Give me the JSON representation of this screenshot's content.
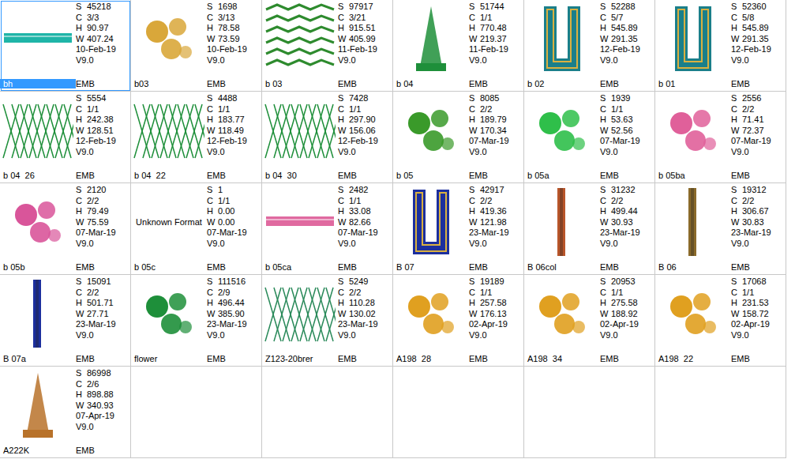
{
  "field_labels": [
    "S",
    "C",
    "H",
    "W"
  ],
  "items": [
    {
      "name": "bh",
      "values": [
        "45218",
        "3/3",
        "90.97",
        "407.24"
      ],
      "date": "10-Feb-19",
      "version": "V9.0",
      "format": "EMB",
      "kind": "band",
      "color": "#1fb5a8",
      "selected": true
    },
    {
      "name": "b03",
      "values": [
        "1698",
        "3/13",
        "78.58",
        "73.59"
      ],
      "date": "10-Feb-19",
      "version": "V9.0",
      "format": "EMB",
      "kind": "motif",
      "color": "#d9a73a",
      "selected": false
    },
    {
      "name": "b 03",
      "values": [
        "97917",
        "3/21",
        "915.51",
        "405.99"
      ],
      "date": "11-Feb-19",
      "version": "V9.0",
      "format": "EMB",
      "kind": "zigzag",
      "color": "#2e8b2e",
      "selected": false
    },
    {
      "name": "b 04",
      "values": [
        "51744",
        "1/1",
        "770.48",
        "219.37"
      ],
      "date": "11-Feb-19",
      "version": "V9.0",
      "format": "EMB",
      "kind": "triangle",
      "color": "#1e8f3a",
      "selected": false
    },
    {
      "name": "b 02",
      "values": [
        "52288",
        "5/7",
        "545.89",
        "291.35"
      ],
      "date": "12-Feb-19",
      "version": "V9.0",
      "format": "EMB",
      "kind": "vshape",
      "color": "#1a7f8a",
      "selected": false
    },
    {
      "name": "b 01",
      "values": [
        "52360",
        "5/8",
        "545.89",
        "291.35"
      ],
      "date": "12-Feb-19",
      "version": "V9.0",
      "format": "EMB",
      "kind": "vshape",
      "color": "#1a7f8a",
      "selected": false
    },
    {
      "name": "b 04  26",
      "values": [
        "5554",
        "1/1",
        "242.38",
        "128.51"
      ],
      "date": "12-Feb-19",
      "version": "V9.0",
      "format": "EMB",
      "kind": "pattern",
      "color": "#1e8f3a",
      "selected": false
    },
    {
      "name": "b 04  22",
      "values": [
        "4488",
        "1/1",
        "183.77",
        "118.49"
      ],
      "date": "12-Feb-19",
      "version": "V9.0",
      "format": "EMB",
      "kind": "pattern",
      "color": "#1e8f3a",
      "selected": false
    },
    {
      "name": "b 04  30",
      "values": [
        "7428",
        "1/1",
        "297.90",
        "156.06"
      ],
      "date": "12-Feb-19",
      "version": "V9.0",
      "format": "EMB",
      "kind": "pattern",
      "color": "#1e8f3a",
      "selected": false
    },
    {
      "name": "b 05",
      "values": [
        "8085",
        "2/2",
        "189.79",
        "170.34"
      ],
      "date": "07-Mar-19",
      "version": "V9.0",
      "format": "EMB",
      "kind": "motif",
      "color": "#3a9a2a",
      "selected": false
    },
    {
      "name": "b 05a",
      "values": [
        "1939",
        "1/1",
        "53.63",
        "52.56"
      ],
      "date": "07-Mar-19",
      "version": "V9.0",
      "format": "EMB",
      "kind": "motif",
      "color": "#2fbf4a",
      "selected": false
    },
    {
      "name": "b 05ba",
      "values": [
        "2556",
        "2/2",
        "71.41",
        "72.37"
      ],
      "date": "07-Mar-19",
      "version": "V9.0",
      "format": "EMB",
      "kind": "motif",
      "color": "#e0609a",
      "selected": false
    },
    {
      "name": "b 05b",
      "values": [
        "2120",
        "2/2",
        "79.49",
        "75.59"
      ],
      "date": "07-Mar-19",
      "version": "V9.0",
      "format": "EMB",
      "kind": "motif",
      "color": "#d9559a",
      "selected": false
    },
    {
      "name": "b 05c",
      "values": [
        "1",
        "1/1",
        "0.00",
        "0.00"
      ],
      "date": "07-Mar-19",
      "version": "V9.0",
      "format": "EMB",
      "kind": "unknown",
      "thumb_text": "Unknown Format",
      "color": "#000000",
      "selected": false
    },
    {
      "name": "b 05ca",
      "values": [
        "2482",
        "1/1",
        "33.08",
        "82.66"
      ],
      "date": "07-Mar-19",
      "version": "V9.0",
      "format": "EMB",
      "kind": "band",
      "color": "#e06aa0",
      "selected": false
    },
    {
      "name": "B 07",
      "values": [
        "42917",
        "2/2",
        "419.36",
        "121.98"
      ],
      "date": "23-Mar-19",
      "version": "V9.0",
      "format": "EMB",
      "kind": "vshape",
      "color": "#1c2f9e",
      "selected": false
    },
    {
      "name": "B 06col",
      "values": [
        "31232",
        "2/2",
        "499.44",
        "30.93"
      ],
      "date": "23-Mar-19",
      "version": "V9.0",
      "format": "EMB",
      "kind": "column",
      "color": "#b8552a",
      "selected": false
    },
    {
      "name": "B 06",
      "values": [
        "19312",
        "2/2",
        "306.67",
        "30.83"
      ],
      "date": "23-Mar-19",
      "version": "V9.0",
      "format": "EMB",
      "kind": "column",
      "color": "#8a6a2a",
      "selected": false
    },
    {
      "name": "B 07a",
      "values": [
        "15091",
        "2/2",
        "501.71",
        "27.71"
      ],
      "date": "23-Mar-19",
      "version": "V9.0",
      "format": "EMB",
      "kind": "column",
      "color": "#1c2f9e",
      "selected": false
    },
    {
      "name": "flower",
      "values": [
        "111516",
        "2/9",
        "496.44",
        "385.90"
      ],
      "date": "23-Mar-19",
      "version": "V9.0",
      "format": "EMB",
      "kind": "motif",
      "color": "#1e8f3a",
      "selected": false
    },
    {
      "name": "Z123-20brer",
      "values": [
        "5249",
        "2/2",
        "110.28",
        "130.02"
      ],
      "date": "23-Mar-19",
      "version": "V9.0",
      "format": "EMB",
      "kind": "pattern",
      "color": "#2a8a5a",
      "selected": false
    },
    {
      "name": "A198  28",
      "values": [
        "19189",
        "1/1",
        "257.58",
        "176.13"
      ],
      "date": "02-Apr-19",
      "version": "V9.0",
      "format": "EMB",
      "kind": "motif",
      "color": "#e0a020",
      "selected": false
    },
    {
      "name": "A198  34",
      "values": [
        "20953",
        "1/1",
        "275.58",
        "188.92"
      ],
      "date": "02-Apr-19",
      "version": "V9.0",
      "format": "EMB",
      "kind": "motif",
      "color": "#e0a020",
      "selected": false
    },
    {
      "name": "A198  22",
      "values": [
        "17068",
        "1/1",
        "231.53",
        "158.72"
      ],
      "date": "02-Apr-19",
      "version": "V9.0",
      "format": "EMB",
      "kind": "motif",
      "color": "#e0a020",
      "selected": false
    },
    {
      "name": "A222K",
      "values": [
        "86998",
        "2/6",
        "898.88",
        "340.93"
      ],
      "date": "07-Apr-19",
      "version": "V9.0",
      "format": "EMB",
      "kind": "triangle",
      "color": "#b8722a",
      "selected": false
    }
  ]
}
